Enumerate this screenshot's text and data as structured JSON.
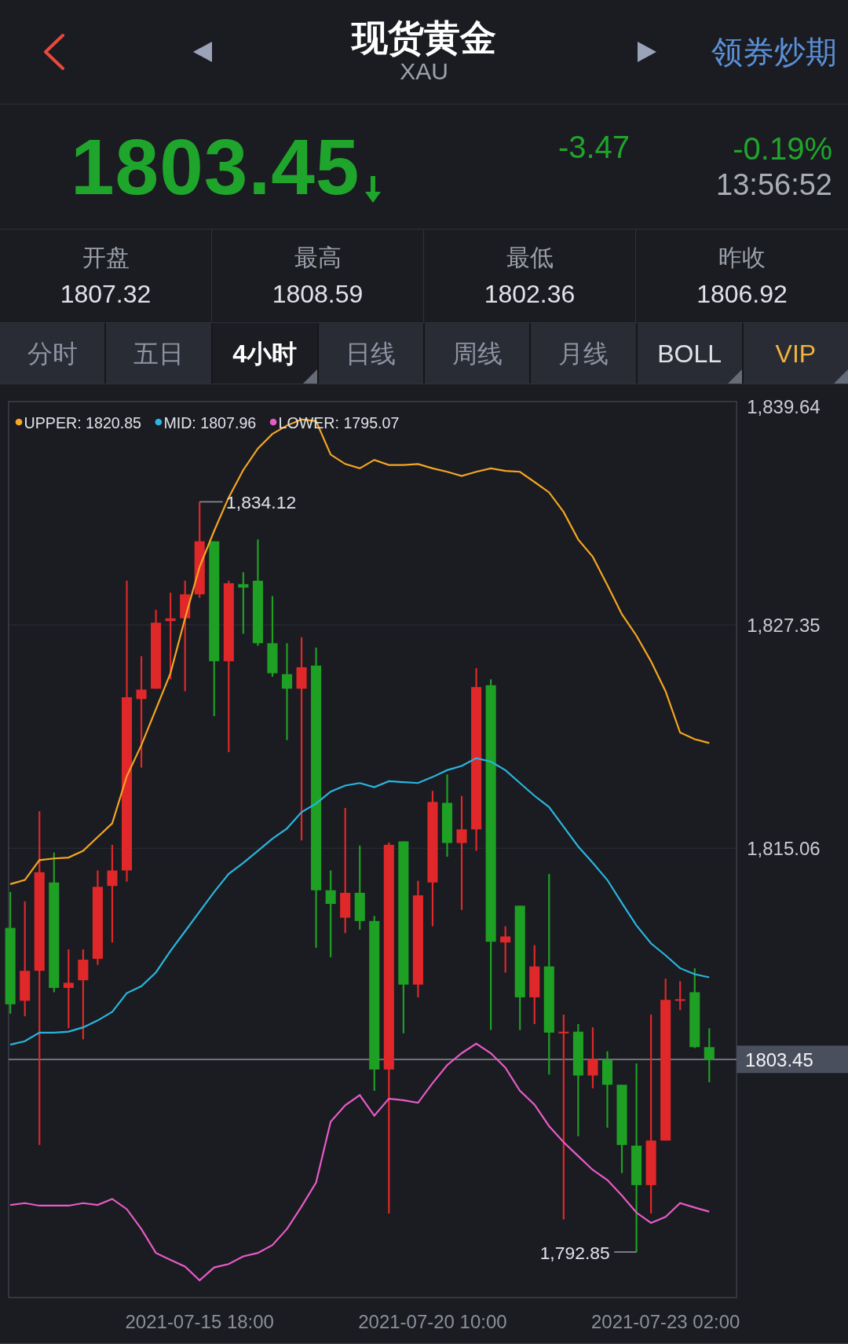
{
  "header": {
    "title": "现货黄金",
    "code": "XAU",
    "action": "领券炒期"
  },
  "quote": {
    "price": "1803.45",
    "falling": true,
    "change": "-3.47",
    "change_pct": "-0.19%",
    "time": "13:56:52"
  },
  "stats": [
    {
      "label": "开盘",
      "value": "1807.32"
    },
    {
      "label": "最高",
      "value": "1808.59"
    },
    {
      "label": "最低",
      "value": "1802.36"
    },
    {
      "label": "昨收",
      "value": "1806.92"
    }
  ],
  "tabs": [
    {
      "label": "分时",
      "kind": "period",
      "selected": false,
      "dropdown": false
    },
    {
      "label": "五日",
      "kind": "period",
      "selected": false,
      "dropdown": false
    },
    {
      "label": "4小时",
      "kind": "period",
      "selected": true,
      "dropdown": true
    },
    {
      "label": "日线",
      "kind": "period",
      "selected": false,
      "dropdown": false
    },
    {
      "label": "周线",
      "kind": "period",
      "selected": false,
      "dropdown": false
    },
    {
      "label": "月线",
      "kind": "period",
      "selected": false,
      "dropdown": false
    },
    {
      "label": "BOLL",
      "kind": "indicator",
      "selected": false,
      "dropdown": true
    },
    {
      "label": "VIP",
      "kind": "vip",
      "selected": false,
      "dropdown": true
    }
  ],
  "chart": {
    "chart_data": {
      "type": "candlestick",
      "categories": [
        null,
        null,
        null,
        null,
        null,
        null,
        null,
        null,
        null,
        null,
        null,
        null,
        null,
        "2021-07-15 18:00",
        null,
        null,
        null,
        null,
        null,
        null,
        null,
        null,
        null,
        null,
        null,
        null,
        null,
        null,
        null,
        "2021-07-20 10:00",
        null,
        null,
        null,
        null,
        null,
        null,
        null,
        null,
        null,
        null,
        null,
        null,
        null,
        null,
        null,
        "2021-07-23 02:00",
        null,
        null,
        null
      ],
      "ylim": [
        1790.35,
        1839.64
      ],
      "yticks": [
        {
          "value": 1839.64,
          "label": "1,839.64"
        },
        {
          "value": 1827.35,
          "label": "1,827.35"
        },
        {
          "value": 1815.06,
          "label": "1,815.06"
        }
      ],
      "series": [
        {
          "name": "UPPER: 1820.85",
          "type": "line",
          "color": "#f5a623",
          "values": [
            1813.09,
            1813.32,
            1814.41,
            1814.5,
            1814.55,
            1814.92,
            1815.68,
            1816.43,
            1819.03,
            1820.73,
            1822.71,
            1824.69,
            1827.71,
            1830.54,
            1832.52,
            1834.36,
            1835.87,
            1837.05,
            1837.85,
            1838.32,
            1838.65,
            1838.56,
            1836.72,
            1836.2,
            1835.96,
            1836.43,
            1836.15,
            1836.15,
            1836.2,
            1835.96,
            1835.77,
            1835.54,
            1835.77,
            1835.96,
            1835.82,
            1835.77,
            1835.21,
            1834.64,
            1833.56,
            1832.05,
            1831.1,
            1829.55,
            1827.94,
            1826.76,
            1825.35,
            1823.7,
            1821.43,
            1821.06,
            1820.85
          ]
        },
        {
          "name": "MID: 1807.96",
          "type": "line",
          "color": "#29b6e0",
          "values": [
            1804.26,
            1804.45,
            1804.92,
            1804.92,
            1804.97,
            1805.21,
            1805.59,
            1806.06,
            1807.09,
            1807.47,
            1808.23,
            1809.41,
            1810.49,
            1811.58,
            1812.66,
            1813.65,
            1814.26,
            1814.92,
            1815.59,
            1816.15,
            1817.05,
            1817.52,
            1818.18,
            1818.51,
            1818.65,
            1818.42,
            1818.75,
            1818.7,
            1818.65,
            1818.98,
            1819.36,
            1819.59,
            1820.02,
            1819.83,
            1819.36,
            1818.65,
            1817.95,
            1817.33,
            1816.25,
            1815.16,
            1814.26,
            1813.32,
            1812.05,
            1810.82,
            1809.83,
            1809.17,
            1808.46,
            1808.13,
            1807.96
          ]
        },
        {
          "name": "LOWER: 1795.07",
          "type": "line",
          "color": "#e85bc8",
          "values": [
            1795.44,
            1795.54,
            1795.4,
            1795.4,
            1795.4,
            1795.54,
            1795.44,
            1795.77,
            1795.21,
            1794.12,
            1792.8,
            1792.42,
            1792.05,
            1791.29,
            1792.0,
            1792.19,
            1792.61,
            1792.8,
            1793.23,
            1794.12,
            1795.35,
            1796.67,
            1800.02,
            1800.92,
            1801.48,
            1800.35,
            1801.29,
            1801.2,
            1801.06,
            1802.14,
            1803.13,
            1803.79,
            1804.31,
            1803.79,
            1802.99,
            1801.72,
            1800.96,
            1799.78,
            1798.89,
            1798.13,
            1797.37,
            1796.81,
            1795.96,
            1795.02,
            1794.45,
            1794.78,
            1795.54,
            1795.3,
            1795.07
          ]
        }
      ],
      "ohlc": [
        [
          1810.68,
          1812.66,
          1805.96,
          1806.48
        ],
        [
          1806.67,
          1812.14,
          1805.82,
          1808.32
        ],
        [
          1808.32,
          1817.09,
          1798.74,
          1813.74
        ],
        [
          1813.18,
          1814.83,
          1807.14,
          1807.38
        ],
        [
          1807.38,
          1809.5,
          1805.16,
          1807.66
        ],
        [
          1807.8,
          1809.5,
          1804.55,
          1808.93
        ],
        [
          1808.98,
          1813.84,
          1808.65,
          1812.94
        ],
        [
          1812.99,
          1815.25,
          1809.88,
          1813.84
        ],
        [
          1813.84,
          1829.78,
          1813.22,
          1823.37
        ],
        [
          1823.27,
          1825.63,
          1819.5,
          1823.79
        ],
        [
          1823.84,
          1828.18,
          1823.84,
          1827.47
        ],
        [
          1827.56,
          1829.12,
          1824.36,
          1827.71
        ],
        [
          1827.71,
          1829.78,
          1823.7,
          1829.03
        ],
        [
          1829.03,
          1834.12,
          1828.84,
          1831.95
        ],
        [
          1831.95,
          1831.95,
          1822.33,
          1825.35
        ],
        [
          1825.35,
          1829.78,
          1820.35,
          1829.64
        ],
        [
          1829.59,
          1830.25,
          1826.86,
          1829.4
        ],
        [
          1829.78,
          1832.05,
          1826.2,
          1826.34
        ],
        [
          1826.34,
          1828.93,
          1824.5,
          1824.69
        ],
        [
          1824.64,
          1826.34,
          1821.01,
          1823.84
        ],
        [
          1823.84,
          1826.67,
          1815.49,
          1825.02
        ],
        [
          1825.11,
          1826.1,
          1809.59,
          1812.75
        ],
        [
          1812.75,
          1813.84,
          1809.07,
          1812.0
        ],
        [
          1811.24,
          1817.28,
          1810.39,
          1812.61
        ],
        [
          1812.61,
          1815.21,
          1810.58,
          1811.06
        ],
        [
          1811.06,
          1811.34,
          1801.72,
          1802.89
        ],
        [
          1802.89,
          1815.39,
          1794.97,
          1815.25
        ],
        [
          1815.44,
          1815.44,
          1804.88,
          1807.56
        ],
        [
          1807.56,
          1813.27,
          1806.86,
          1812.47
        ],
        [
          1813.18,
          1818.22,
          1810.77,
          1817.61
        ],
        [
          1817.56,
          1819.12,
          1814.59,
          1815.35
        ],
        [
          1815.35,
          1817.94,
          1811.67,
          1816.1
        ],
        [
          1816.1,
          1824.97,
          1814.92,
          1823.93
        ],
        [
          1824.03,
          1824.36,
          1805.06,
          1809.92
        ],
        [
          1809.88,
          1810.77,
          1808.22,
          1810.21
        ],
        [
          1811.9,
          1811.9,
          1805.06,
          1806.86
        ],
        [
          1806.86,
          1809.73,
          1805.39,
          1808.56
        ],
        [
          1808.56,
          1813.65,
          1802.61,
          1804.92
        ],
        [
          1804.88,
          1805.91,
          1794.64,
          1804.97
        ],
        [
          1804.97,
          1805.39,
          1799.22,
          1802.56
        ],
        [
          1802.56,
          1805.21,
          1801.86,
          1803.46
        ],
        [
          1803.41,
          1803.89,
          1799.69,
          1802.05
        ],
        [
          1802.05,
          1802.05,
          1797.19,
          1798.74
        ],
        [
          1798.7,
          1803.22,
          1792.85,
          1796.53
        ],
        [
          1796.53,
          1805.91,
          1794.97,
          1798.98
        ],
        [
          1798.98,
          1807.89,
          1798.98,
          1806.72
        ],
        [
          1806.67,
          1807.75,
          1806.15,
          1806.76
        ],
        [
          1807.14,
          1808.46,
          1804.07,
          1804.12
        ],
        [
          1804.12,
          1805.16,
          1802.19,
          1803.45
        ]
      ],
      "legend": "top-left",
      "annotations": [
        "1,834.12",
        "1,792.85"
      ],
      "ref_lines": [
        {
          "axis": "y",
          "value": 1803.45,
          "label": "1803.45"
        }
      ]
    }
  }
}
